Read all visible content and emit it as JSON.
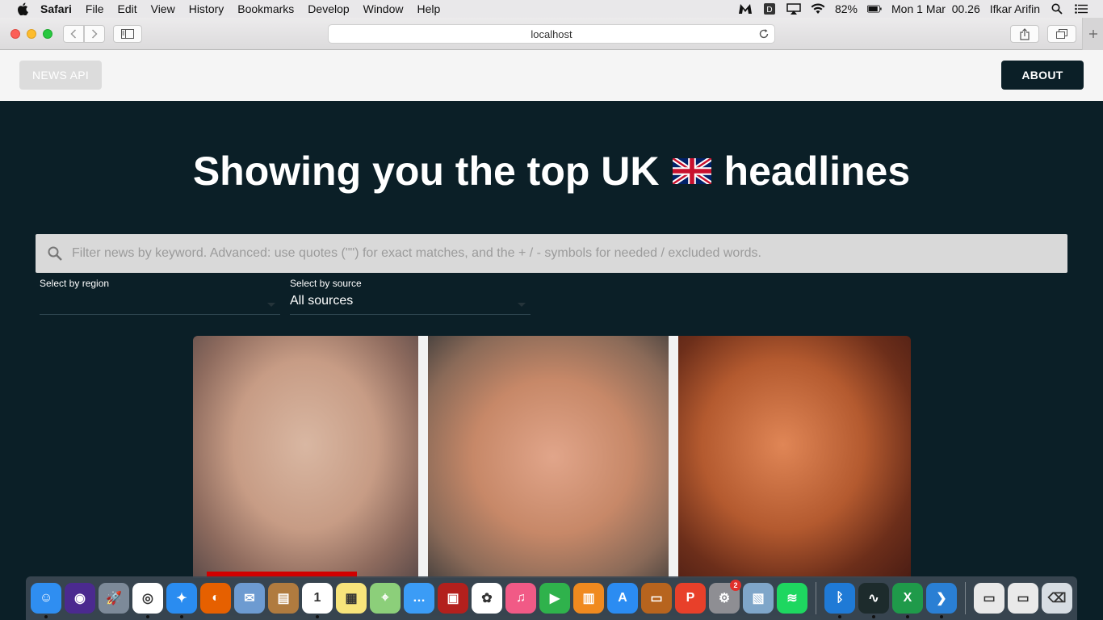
{
  "menubar": {
    "app": "Safari",
    "items": [
      "File",
      "Edit",
      "View",
      "History",
      "Bookmarks",
      "Develop",
      "Window",
      "Help"
    ],
    "battery": "82%",
    "datetime": "Mon 1 Mar  00.26",
    "user": "Ifkar Arifin"
  },
  "browser": {
    "url": "localhost"
  },
  "header": {
    "brand": "NEWS API",
    "about": "ABOUT"
  },
  "main": {
    "headline_pre": "Showing you the top UK",
    "headline_post": "headlines",
    "search_placeholder": "Filter news by keyword. Advanced: use quotes (\"\") for exact matches, and the + / - symbols for needed / excluded words.",
    "region_label": "Select by region",
    "region_value": "",
    "source_label": "Select by source",
    "source_value": "All sources"
  },
  "dock": {
    "items": [
      {
        "name": "finder-icon",
        "color": "#2f8ef1",
        "glyph": "☺"
      },
      {
        "name": "siri-icon",
        "color": "#4b2a8f",
        "glyph": "◉"
      },
      {
        "name": "launchpad-icon",
        "color": "#7d8a99",
        "glyph": "🚀"
      },
      {
        "name": "chrome-icon",
        "color": "#ffffff",
        "glyph": "◎"
      },
      {
        "name": "safari-icon",
        "color": "#2a8cf0",
        "glyph": "✦"
      },
      {
        "name": "firefox-icon",
        "color": "#e66000",
        "glyph": "◐"
      },
      {
        "name": "mail-stamp-icon",
        "color": "#6d9bd1",
        "glyph": "✉"
      },
      {
        "name": "contacts-icon",
        "color": "#b07b3f",
        "glyph": "▤"
      },
      {
        "name": "calendar-icon",
        "color": "#ffffff",
        "glyph": "1"
      },
      {
        "name": "notes-icon",
        "color": "#f7e47b",
        "glyph": "▦"
      },
      {
        "name": "maps-icon",
        "color": "#8ccf7a",
        "glyph": "⌖"
      },
      {
        "name": "messages-icon",
        "color": "#3b9cf6",
        "glyph": "…"
      },
      {
        "name": "photo-booth-icon",
        "color": "#b3201d",
        "glyph": "▣"
      },
      {
        "name": "photos-icon",
        "color": "#ffffff",
        "glyph": "✿"
      },
      {
        "name": "itunes-icon",
        "color": "#f15a86",
        "glyph": "♫"
      },
      {
        "name": "facetime-icon",
        "color": "#2fb24c",
        "glyph": "▶"
      },
      {
        "name": "books-icon",
        "color": "#f08a1f",
        "glyph": "▥"
      },
      {
        "name": "app-store-icon",
        "color": "#2b8cf2",
        "glyph": "A"
      },
      {
        "name": "keynote-icon",
        "color": "#b7641e",
        "glyph": "▭"
      },
      {
        "name": "wps-icon",
        "color": "#e8402a",
        "glyph": "P"
      },
      {
        "name": "system-preferences-icon",
        "color": "#8e8e93",
        "glyph": "⚙"
      },
      {
        "name": "preview-icon",
        "color": "#7fa6c9",
        "glyph": "▧"
      },
      {
        "name": "spotify-icon",
        "color": "#1ed760",
        "glyph": "≋"
      },
      {
        "name": "bluetooth-icon",
        "color": "#1f7ad6",
        "glyph": "ᛒ"
      },
      {
        "name": "activity-monitor-icon",
        "color": "#1d2b2c",
        "glyph": "∿"
      },
      {
        "name": "excel-icon",
        "color": "#1f9a4a",
        "glyph": "X"
      },
      {
        "name": "vscode-icon",
        "color": "#2a7fd4",
        "glyph": "❯"
      },
      {
        "name": "window-thumb-icon",
        "color": "#e9e9e9",
        "glyph": "▭"
      },
      {
        "name": "chrome-window-icon",
        "color": "#e9e9e9",
        "glyph": "▭"
      },
      {
        "name": "trash-icon",
        "color": "#d7dde3",
        "glyph": "⌫"
      }
    ]
  }
}
